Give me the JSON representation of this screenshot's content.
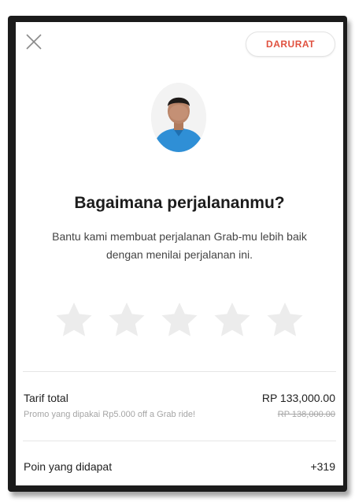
{
  "header": {
    "close_icon": "close-icon",
    "emergency_label": "DARURAT",
    "emergency_color": "#e0513f"
  },
  "driver": {
    "avatar_icon": "avatar-photo"
  },
  "rating": {
    "title": "Bagaimana perjalananmu?",
    "subtitle_line1": "Bantu kami membuat perjalanan Grab-mu lebih baik",
    "subtitle_line2": "dengan menilai perjalanan ini.",
    "stars_total": 5,
    "stars_selected": 0,
    "star_color": "#ececec"
  },
  "fare": {
    "label": "Tarif total",
    "value": "RP 133,000.00",
    "promo_text": "Promo yang dipakai Rp5.000 off a Grab ride!",
    "original_value": "RP 138,000.00"
  },
  "points": {
    "label": "Poin yang didapat",
    "value": "+319"
  }
}
